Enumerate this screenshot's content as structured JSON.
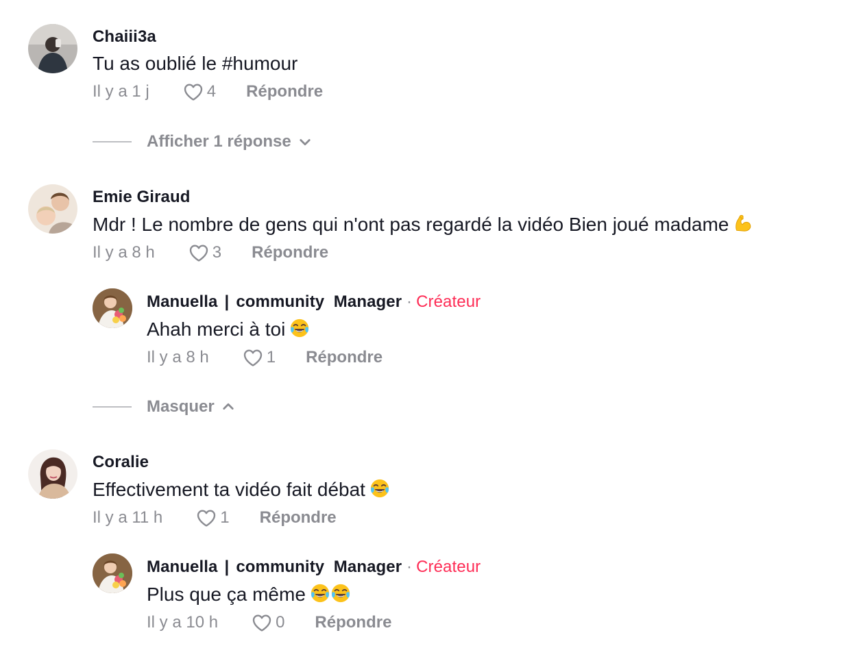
{
  "comments": [
    {
      "author": "Chaiii3a",
      "text": "Tu as oublié le #humour",
      "time": "Il y a 1 j",
      "likes": "4",
      "reply_label": "Répondre",
      "toggle_label": "Afficher 1 réponse"
    },
    {
      "author": "Emie Giraud",
      "text": "Mdr ! Le nombre de gens qui n'ont pas regardé la vidéo Bien joué madame",
      "emoji": "flexed-biceps",
      "time": "Il y a 8 h",
      "likes": "3",
      "reply_label": "Répondre",
      "toggle_label": "Masquer",
      "replies": [
        {
          "author_part1": "Manuella",
          "author_sep": "|",
          "author_part2": "community  Manager",
          "creator_tag": "Créateur",
          "text": "Ahah merci à toi",
          "emoji": "face-with-tears-of-joy",
          "time": "Il y a 8 h",
          "likes": "1",
          "reply_label": "Répondre"
        }
      ]
    },
    {
      "author": "Coralie",
      "text": "Effectivement ta vidéo fait débat",
      "emoji": "face-with-tears-of-joy",
      "time": "Il y a 11 h",
      "likes": "1",
      "reply_label": "Répondre",
      "replies": [
        {
          "author_part1": "Manuella",
          "author_sep": "|",
          "author_part2": "community  Manager",
          "creator_tag": "Créateur",
          "text": "Plus que ça même",
          "emoji": "face-with-tears-of-joy x2",
          "time": "Il y a 10 h",
          "likes": "0",
          "reply_label": "Répondre"
        }
      ]
    }
  ],
  "colors": {
    "text_primary": "#161823",
    "text_secondary": "#8a8b91",
    "creator_accent": "#fe2c55",
    "divider": "#bdbec2"
  }
}
